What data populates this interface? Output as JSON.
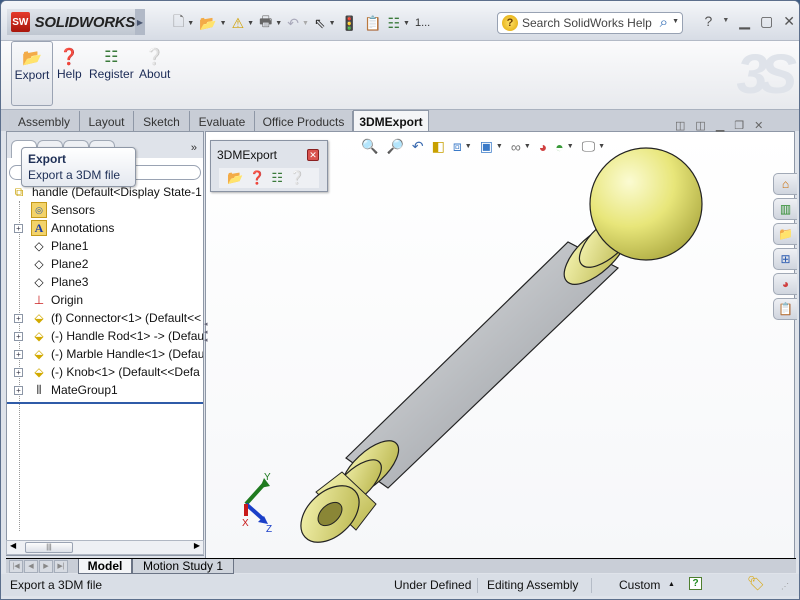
{
  "app": {
    "brand": "SOLIDWORKS",
    "brand_badge": "SW"
  },
  "quick_access": {
    "items": [
      "new-document",
      "open",
      "save",
      "print",
      "undo",
      "select",
      "rebuild",
      "file-properties",
      "options"
    ],
    "overflow_label": "1...",
    "search_placeholder": "Search SolidWorks Help"
  },
  "window_controls": [
    "help",
    "minimize",
    "restore",
    "close"
  ],
  "command_manager": {
    "buttons": [
      {
        "label": "Export",
        "icon": "export-folder-icon"
      },
      {
        "label": "Help",
        "icon": "help-doc-icon"
      },
      {
        "label": "Register",
        "icon": "register-list-icon"
      },
      {
        "label": "About",
        "icon": "about-question-icon"
      }
    ]
  },
  "ribbon_tabs": [
    {
      "label": "Assembly",
      "active": false
    },
    {
      "label": "Layout",
      "active": false
    },
    {
      "label": "Sketch",
      "active": false
    },
    {
      "label": "Evaluate",
      "active": false
    },
    {
      "label": "Office Products",
      "active": false
    },
    {
      "label": "3DMExport",
      "active": true
    }
  ],
  "tooltip": {
    "title": "Export",
    "description": "Export a 3DM file"
  },
  "feature_tree": {
    "more_label": "»",
    "items": [
      {
        "label": "handle  (Default<Display State-1",
        "icon": "assembly-icon",
        "expander": false,
        "root": true
      },
      {
        "label": "Sensors",
        "icon": "sensors-folder-icon",
        "expander": false
      },
      {
        "label": "Annotations",
        "icon": "annotations-icon",
        "expander": true
      },
      {
        "label": "Plane1",
        "icon": "plane-icon",
        "expander": false
      },
      {
        "label": "Plane2",
        "icon": "plane-icon",
        "expander": false
      },
      {
        "label": "Plane3",
        "icon": "plane-icon",
        "expander": false
      },
      {
        "label": "Origin",
        "icon": "origin-icon",
        "expander": false
      },
      {
        "label": "(f) Connector<1> (Default<<",
        "icon": "part-icon",
        "expander": true
      },
      {
        "label": "(-) Handle Rod<1> -> (Defau",
        "icon": "part-icon",
        "expander": true
      },
      {
        "label": "(-) Marble Handle<1> (Defau",
        "icon": "part-icon",
        "expander": true
      },
      {
        "label": "(-) Knob<1> (Default<<Defa",
        "icon": "part-icon",
        "expander": true
      },
      {
        "label": "MateGroup1",
        "icon": "mates-icon",
        "expander": true
      }
    ]
  },
  "floating_toolbar": {
    "title": "3DMExport",
    "icons": [
      "export-folder-icon",
      "help-doc-icon",
      "register-list-icon",
      "about-question-icon"
    ]
  },
  "heads_up_toolbar": [
    "zoom-to-fit",
    "zoom-to-area",
    "previous-view",
    "section-view",
    "view-orientation",
    "display-style",
    "hide-show-items",
    "edit-appearance",
    "apply-scene",
    "view-settings"
  ],
  "task_pane_tabs": [
    "solidworks-resources",
    "design-library",
    "file-explorer",
    "view-palette",
    "appearances-scenes",
    "custom-properties"
  ],
  "triad": {
    "x": "X",
    "y": "Y",
    "z": "Z"
  },
  "bottom_tabs": [
    {
      "label": "Model",
      "active": true
    },
    {
      "label": "Motion Study 1",
      "active": false
    }
  ],
  "status_bar": {
    "message": "Export a 3DM file",
    "definition": "Under Defined",
    "mode": "Editing Assembly",
    "units": "Custom",
    "units_arrow": "▲"
  },
  "colors": {
    "part_yellow": "#e8e67a",
    "rod_gray": "#b9bcc0",
    "accent_blue": "#2f5ba8"
  }
}
